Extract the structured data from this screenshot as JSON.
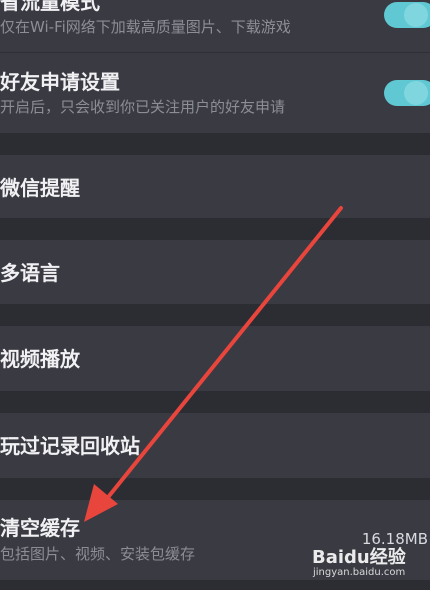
{
  "settings": {
    "traffic_mode": {
      "title": "省流量模式",
      "subtitle": "仅在Wi-Fi网络下加载高质量图片、下载游戏",
      "enabled": true
    },
    "friend_request": {
      "title": "好友申请设置",
      "subtitle": "开启后，只会收到你已关注用户的好友申请",
      "enabled": true
    },
    "wechat_reminder": {
      "title": "微信提醒"
    },
    "language": {
      "title": "多语言"
    },
    "video_playback": {
      "title": "视频播放"
    },
    "played_recycle": {
      "title": "玩过记录回收站"
    },
    "clear_cache": {
      "title": "清空缓存",
      "subtitle": "包括图片、视频、安装包缓存",
      "value": "16.18MB"
    }
  },
  "watermark": {
    "logo": "Baidu经验",
    "url": "jingyan.baidu.com"
  },
  "colors": {
    "background": "#2c2d33",
    "row": "#393a42",
    "toggle_on": "#5fc8d2",
    "arrow": "#e8453c"
  },
  "icons": [
    "toggle-switch",
    "annotation-arrow"
  ]
}
